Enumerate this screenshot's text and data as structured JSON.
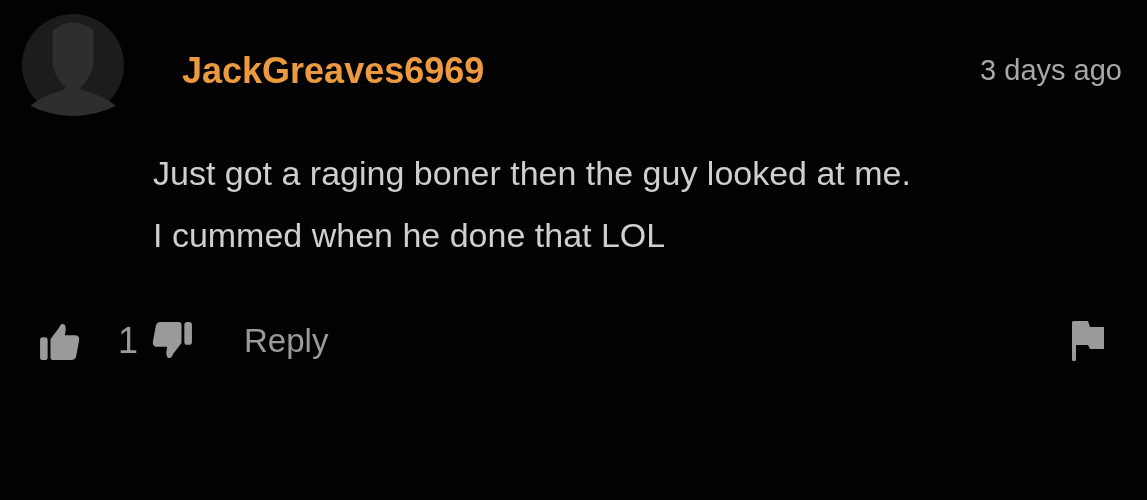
{
  "comment": {
    "username": "JackGreaves6969",
    "time": "3 days ago",
    "paragraphs": [
      "Just got a raging boner then the guy looked at me.",
      "I cummed when he done that LOL"
    ],
    "likes": "1",
    "reply": "Reply"
  }
}
